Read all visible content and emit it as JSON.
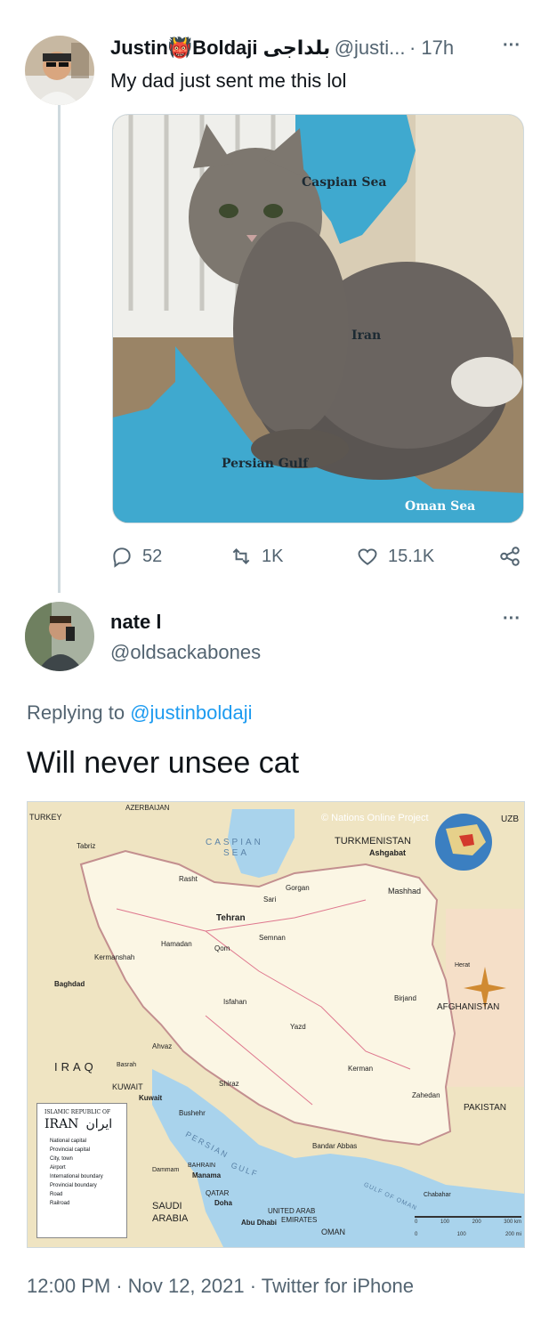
{
  "tweet1": {
    "display_name": "Justin👹Boldaji بلداجی",
    "handle": "@justi...",
    "time": "· 17h",
    "more": "···",
    "text": "My dad just sent me this lol",
    "image_labels": {
      "caspian": "Caspian Sea",
      "iran": "Iran",
      "persian_gulf": "Persian Gulf",
      "oman": "Oman Sea"
    },
    "actions": {
      "replies": "52",
      "retweets": "1K",
      "likes": "15.1K"
    }
  },
  "tweet2": {
    "display_name": "nate l",
    "handle": "@oldsackabones",
    "more": "···",
    "replying_prefix": "Replying to ",
    "replying_handle": "@justinboldaji",
    "text": "Will never unsee cat",
    "map": {
      "credit": "© Nations Online Project",
      "countries": {
        "turkmenistan": "TURKMENISTAN",
        "afghanistan": "AFGHANISTAN",
        "pakistan": "PAKISTAN",
        "iraq": "IRAQ",
        "saudi": "SAUDI",
        "arabia": "ARABIA",
        "kuwait": "KUWAIT",
        "qatar": "QATAR",
        "bahrain": "BAHRAIN",
        "uae1": "UNITED ARAB",
        "uae2": "EMIRATES",
        "oman": "OMAN",
        "turkey": "TURKEY",
        "azerbaijan": "AZERBAIJAN",
        "uzb": "UZB"
      },
      "seas": {
        "caspian1": "CASPIAN",
        "caspian2": "SEA",
        "persian": "PERSIAN",
        "gulf": "GULF",
        "gulf_of_oman": "GULF OF OMAN"
      },
      "cities": {
        "tehran": "Tehran",
        "ashgabat": "Ashgabat",
        "mashhad": "Mashhad",
        "isfahan": "Isfahan",
        "shiraz": "Shiraz",
        "kerman": "Kerman",
        "zahedan": "Zahedan",
        "bandar_abbas": "Bandar Abbas",
        "bushehr": "Bushehr",
        "yazd": "Yazd",
        "baghdad": "Baghdad",
        "kuwait_city": "Kuwait",
        "manama": "Manama",
        "doha": "Doha",
        "abu_dhabi": "Abu Dhabi",
        "tabriz": "Tabriz",
        "rasht": "Rasht",
        "kermanshah": "Kermanshah",
        "hamadan": "Hamadan",
        "ahvaz": "Ahvaz",
        "qom": "Qom",
        "birjand": "Birjand",
        "semnan": "Semnan",
        "sari": "Sari",
        "gorgan": "Gorgan",
        "dammam": "Dammam",
        "basrah": "Basrah",
        "herat": "Herat",
        "chabahar": "Chabahar"
      },
      "legend": {
        "header": "ISLAMIC REPUBLIC OF",
        "title": "IRAN",
        "title_fa": "ایران",
        "items": [
          "National capital",
          "Provincial capital",
          "City, town",
          "Airport",
          "International boundary",
          "Provincial boundary",
          "Road",
          "Railroad"
        ]
      },
      "scale": {
        "km": [
          "0",
          "100",
          "200",
          "300 km"
        ],
        "mi": [
          "0",
          "100",
          "200 mi"
        ]
      }
    }
  },
  "footer": "12:00 PM · Nov 12, 2021 · Twitter for iPhone"
}
